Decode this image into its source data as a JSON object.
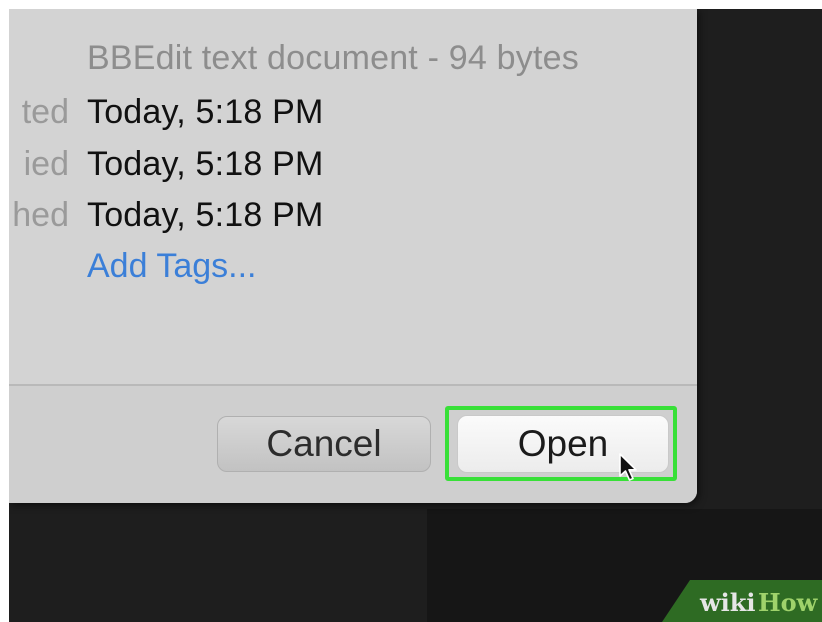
{
  "file_info": {
    "kind": "BBEdit text document - 94 bytes",
    "rows": [
      {
        "label_fragment": "ted",
        "value": "Today, 5:18 PM"
      },
      {
        "label_fragment": "ied",
        "value": "Today, 5:18 PM"
      },
      {
        "label_fragment": "hed",
        "value": "Today, 5:18 PM"
      }
    ],
    "add_tags_label": "Add Tags..."
  },
  "buttons": {
    "cancel_label": "Cancel",
    "open_label": "Open"
  },
  "watermark": {
    "wiki": "wiki",
    "how": "How"
  },
  "colors": {
    "highlight": "#38e038",
    "link": "#3b7fd8",
    "dialog_bg": "#d3d3d3",
    "watermark_bg": "#2e6b23"
  }
}
